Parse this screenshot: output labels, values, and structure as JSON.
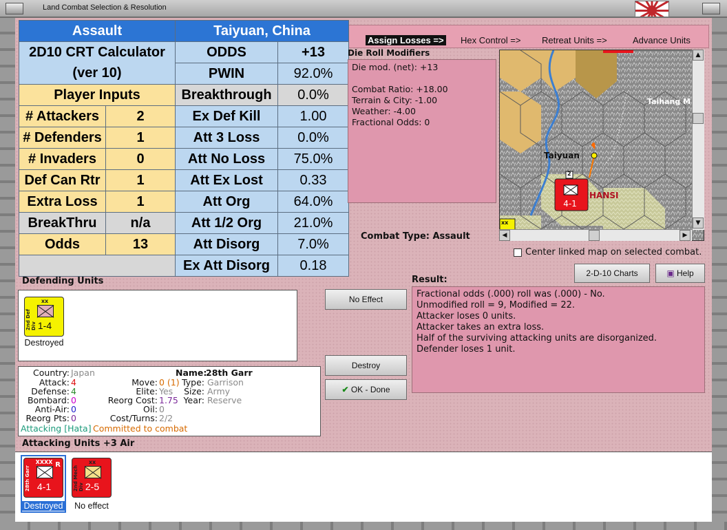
{
  "window": {
    "title": "Land Combat Selection & Resolution"
  },
  "nav": {
    "assign": "Assign Losses =>",
    "hex": "Hex Control =>",
    "retreat": "Retreat Units =>",
    "advance": "Advance Units"
  },
  "crt": {
    "assault": "Assault",
    "location": "Taiyuan, China",
    "calc1": "2D10 CRT Calculator",
    "calc2": "(ver 10)",
    "player_inputs": "Player Inputs",
    "inputs": [
      {
        "label": "# Attackers",
        "value": "2"
      },
      {
        "label": "# Defenders",
        "value": "1"
      },
      {
        "label": "# Invaders",
        "value": "0"
      },
      {
        "label": "Def Can Rtr",
        "value": "1"
      },
      {
        "label": "Extra Loss",
        "value": "1"
      },
      {
        "label": "BreakThru",
        "value": "n/a"
      },
      {
        "label": "Odds",
        "value": "13"
      }
    ],
    "results": [
      {
        "label": "ODDS",
        "value": "+13"
      },
      {
        "label": "PWIN",
        "value": "92.0%"
      },
      {
        "label": "Breakthrough",
        "value": "0.0%"
      },
      {
        "label": "Ex Def Kill",
        "value": "1.00"
      },
      {
        "label": "Att 3 Loss",
        "value": "0.0%"
      },
      {
        "label": "Att No Loss",
        "value": "75.0%"
      },
      {
        "label": "Att Ex Lost",
        "value": "0.33"
      },
      {
        "label": "Att Org",
        "value": "64.0%"
      },
      {
        "label": "Att 1/2 Org",
        "value": "21.0%"
      },
      {
        "label": "Att Disorg",
        "value": "7.0%"
      },
      {
        "label": "Ex Att Disorg",
        "value": "0.18"
      }
    ]
  },
  "drm": {
    "title": "Die Roll Modifiers",
    "lines": [
      "Die mod. (net): +13",
      "",
      "Combat Ratio: +18.00",
      "Terrain & City: -1.00",
      "Weather: -4.00",
      "Fractional Odds: 0"
    ]
  },
  "combat_type": {
    "label": "Combat Type:",
    "value": "Assault"
  },
  "map": {
    "city": "Taiyuan",
    "region": "HANSI",
    "mountains": "Taihang M",
    "counter_value": "4-1",
    "stack": "2",
    "corner": "xx"
  },
  "center_linked": "Center linked map on selected combat.",
  "buttons": {
    "charts": "2-D-10 Charts",
    "help": "Help",
    "no_effect": "No Effect",
    "destroy": "Destroy",
    "ok": "OK - Done"
  },
  "result": {
    "title": "Result:",
    "lines": [
      "Fractional odds (.000) roll was (.000)  - No.",
      "Unmodified roll = 9, Modified = 22.",
      "Attacker loses 0 units.",
      "Attacker takes an extra loss.",
      "Half of the surviving attacking units are disorganized.",
      "Defender loses 1 unit."
    ]
  },
  "defending": {
    "title": "Defending Units",
    "units": [
      {
        "side": "2nd Def Div",
        "size": "xx",
        "value": "1-4",
        "caption": "Destroyed",
        "color": "#f5f200"
      }
    ]
  },
  "info": {
    "country_k": "Country:",
    "country_v": "Japan",
    "attack_k": "Attack:",
    "attack_v": "4",
    "defense_k": "Defense:",
    "defense_v": "4",
    "bombard_k": "Bombard:",
    "bombard_v": "0",
    "antiair_k": "Anti-Air:",
    "antiair_v": "0",
    "reorgpts_k": "Reorg Pts:",
    "reorgpts_v": "0",
    "name_k": "Name:",
    "name_v": "28th Garr",
    "move_k": "Move:",
    "move_v": "0 (1)",
    "elite_k": "Elite:",
    "elite_v": "Yes",
    "reorgcost_k": "Reorg Cost:",
    "reorgcost_v": "1.75",
    "oil_k": "Oil:",
    "oil_v": "0",
    "costturns_k": "Cost/Turns:",
    "costturns_v": "2/2",
    "type_k": "Type:",
    "type_v": "Garrison",
    "size_k": "Size:",
    "size_v": "Army",
    "year_k": "Year:",
    "year_v": "Reserve",
    "attacking": "Attacking [Hata]",
    "committed": "Committed to combat"
  },
  "attacking": {
    "title": "Attacking Units +3 Air",
    "units": [
      {
        "side": "28th Garr",
        "size": "XXXX",
        "value": "4-1",
        "caption": "Destroyed",
        "color": "#e8141c",
        "r": "R"
      },
      {
        "side": "2nd Mech Div",
        "size": "xx",
        "value": "2-5",
        "caption": "No effect",
        "color": "#e8141c",
        "r": ""
      }
    ]
  },
  "colors": {
    "panel_pink": "#dbb3b9",
    "box_pink": "#df97ad",
    "crt_blue": "#2c75d4",
    "crt_light": "#bcd7f0",
    "crt_yellow": "#fbe29c",
    "counter_red": "#e8141c",
    "counter_yellow": "#f5f200"
  }
}
